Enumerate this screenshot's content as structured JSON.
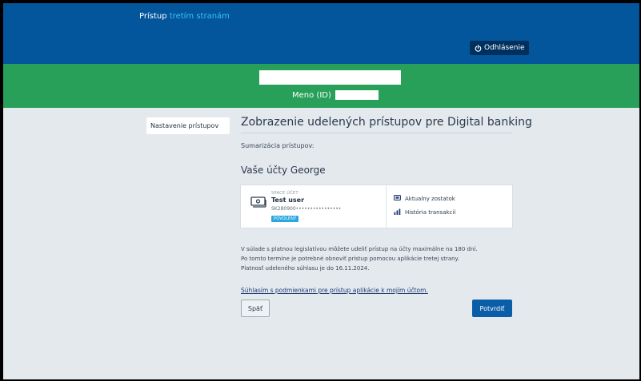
{
  "header": {
    "title_part1": "Prístup",
    "title_part2": "tretím stranám",
    "logout_label": "Odhlásenie",
    "logout_icon": "power-icon"
  },
  "identity": {
    "id_label": "Meno (ID)"
  },
  "sidebar": {
    "items": [
      {
        "label": "Nastavenie prístupov"
      }
    ]
  },
  "main": {
    "title": "Zobrazenie udelených prístupov pre Digital banking",
    "summary_label": "Sumarizácia prístupov:",
    "accounts_heading": "Vaše účty George",
    "account": {
      "type": "SPACE ÚČET",
      "name": "Test user",
      "iban": "SK280900••••••••••••••••",
      "status": "POVOLENÝ",
      "icon": "banknote-icon",
      "permissions": [
        {
          "label": "Aktualny zostatok",
          "icon": "balance-icon"
        },
        {
          "label": "História transakcií",
          "icon": "chart-bars-icon"
        }
      ]
    },
    "info_lines": [
      "V súlade s platnou legislatívou môžete udeliť prístup na účty maximálne na 180 dní.",
      "Po tomto termíne je potrebné obnoviť prístup pomocou aplikácie tretej strany.",
      "Platnosť udeleného súhlasu je do 16.11.2024."
    ],
    "consent_link": "Súhlasím s podmienkami pre prístup aplikácie k mojím účtom.",
    "back_label": "Späť",
    "confirm_label": "Potvrdiť"
  },
  "colors": {
    "header_bg": "#03569b",
    "accent_text": "#3bc1f6",
    "green_bar": "#28a059",
    "page_bg": "#e4e9ee",
    "primary_button": "#0a5ea8",
    "badge": "#2ba8e0"
  }
}
